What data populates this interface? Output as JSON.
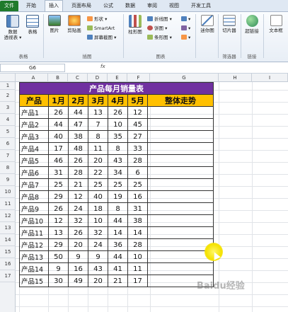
{
  "tabs": [
    "文件",
    "开始",
    "插入",
    "页面布局",
    "公式",
    "数据",
    "审阅",
    "视图",
    "开发工具"
  ],
  "ribbon": {
    "table_group": {
      "pivot": "数据\n透视表 ▾",
      "table": "表格",
      "label": "表格"
    },
    "illus_group": {
      "picture": "图片",
      "clipart": "剪贴画",
      "shapes": "形状 ▾",
      "smartart": "SmartArt",
      "screenshot": "屏幕截图 ▾",
      "label": "插图"
    },
    "chart_group": {
      "column": "柱形图",
      "line": "折线图 ▾",
      "pie": "饼图 ▾",
      "bar": "条形图 ▾",
      "label": "图表"
    },
    "spark_group": {
      "spark": "迷你图",
      "label": ""
    },
    "filter_group": {
      "slicer": "切片器",
      "label": "筛选器"
    },
    "link_group": {
      "hyperlink": "超链接",
      "label": "链接"
    },
    "text_group": {
      "textbox": "文本框"
    }
  },
  "namebox": "G6",
  "fx": "fx",
  "columns": [
    "A",
    "B",
    "C",
    "D",
    "E",
    "F",
    "G",
    "H",
    "I"
  ],
  "rows": [
    "1",
    "2",
    "3",
    "4",
    "5",
    "6",
    "7",
    "8",
    "9",
    "10",
    "11",
    "12",
    "13",
    "14",
    "15",
    "16",
    "17"
  ],
  "table": {
    "title": "产品每月销量表",
    "headers": [
      "产品",
      "1月",
      "2月",
      "3月",
      "4月",
      "5月",
      "整体走势"
    ],
    "rows": [
      [
        "产品1",
        "26",
        "44",
        "13",
        "26",
        "12"
      ],
      [
        "产品2",
        "44",
        "47",
        "7",
        "10",
        "45"
      ],
      [
        "产品3",
        "40",
        "38",
        "8",
        "35",
        "27"
      ],
      [
        "产品4",
        "17",
        "48",
        "11",
        "8",
        "33"
      ],
      [
        "产品5",
        "46",
        "26",
        "20",
        "43",
        "28"
      ],
      [
        "产品6",
        "31",
        "28",
        "22",
        "34",
        "6"
      ],
      [
        "产品7",
        "25",
        "21",
        "25",
        "25",
        "25"
      ],
      [
        "产品8",
        "29",
        "12",
        "40",
        "19",
        "16"
      ],
      [
        "产品9",
        "26",
        "24",
        "18",
        "8",
        "31"
      ],
      [
        "产品10",
        "12",
        "32",
        "10",
        "44",
        "38"
      ],
      [
        "产品11",
        "13",
        "26",
        "32",
        "14",
        "14"
      ],
      [
        "产品12",
        "29",
        "20",
        "24",
        "36",
        "28"
      ],
      [
        "产品13",
        "50",
        "9",
        "9",
        "44",
        "10"
      ],
      [
        "产品14",
        "9",
        "16",
        "43",
        "41",
        "11"
      ],
      [
        "产品15",
        "30",
        "49",
        "20",
        "21",
        "17"
      ]
    ]
  },
  "watermark": "Baidu经验",
  "colors": {
    "title_bg": "#7030a0",
    "header_bg": "#ffc000",
    "file_tab": "#1f7a2c"
  }
}
